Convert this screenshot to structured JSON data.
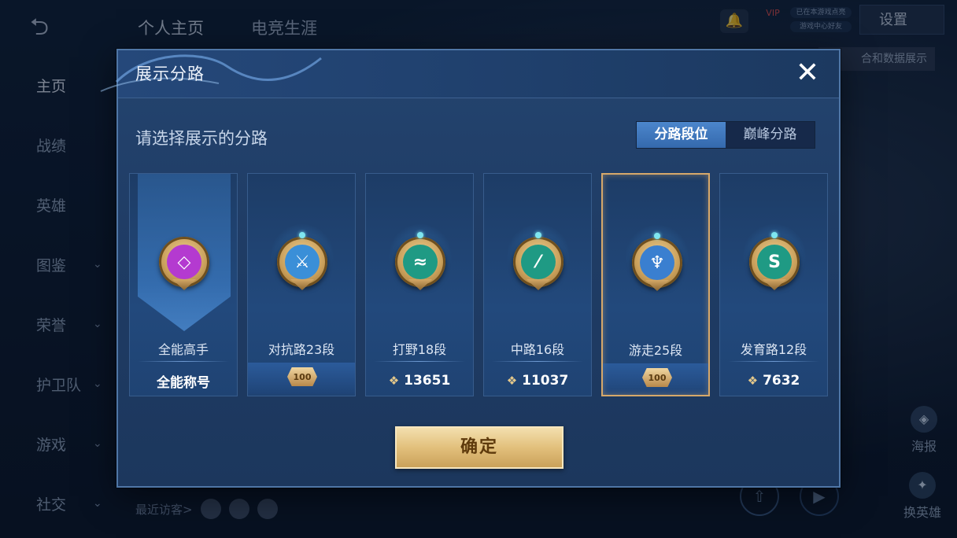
{
  "background": {
    "top_tabs": [
      "个人主页",
      "电竞生涯"
    ],
    "vip_label": "VIP",
    "status_lines": [
      "已在本游戏点亮",
      "游戏中心好友"
    ],
    "settings_label": "设置",
    "data_strip_label": "合和数据展示",
    "side_nav": [
      {
        "label": "主页",
        "has_chevron": false
      },
      {
        "label": "战绩",
        "has_chevron": false
      },
      {
        "label": "英雄",
        "has_chevron": false
      },
      {
        "label": "图鉴",
        "has_chevron": true
      },
      {
        "label": "荣誉",
        "has_chevron": true
      },
      {
        "label": "护卫队",
        "has_chevron": true
      },
      {
        "label": "游戏",
        "has_chevron": true
      },
      {
        "label": "社交",
        "has_chevron": true
      }
    ],
    "right_buttons": [
      {
        "label": "海报",
        "icon": "poster-icon"
      },
      {
        "label": "换英雄",
        "icon": "swap-hero-icon"
      }
    ],
    "recent_visitors_label": "最近访客>"
  },
  "modal": {
    "title": "展示分路",
    "subtitle": "请选择展示的分路",
    "tabs": [
      {
        "label": "分路段位",
        "active": true
      },
      {
        "label": "巅峰分路",
        "active": false
      }
    ],
    "cards": [
      {
        "name": "全能高手",
        "footer": "全能称号",
        "footer_type": "text",
        "badge_color": "#b43ad0",
        "badge_glyph": "◇",
        "selected": false
      },
      {
        "name": "对抗路23段",
        "footer": "100",
        "footer_type": "crest",
        "badge_color": "#3a8fd8",
        "badge_glyph": "⚔",
        "selected": false
      },
      {
        "name": "打野18段",
        "footer": "13651",
        "footer_type": "score",
        "badge_color": "#1f9a84",
        "badge_glyph": "≈",
        "selected": false
      },
      {
        "name": "中路16段",
        "footer": "11037",
        "footer_type": "score",
        "badge_color": "#1f9a84",
        "badge_glyph": "⁄",
        "selected": false
      },
      {
        "name": "游走25段",
        "footer": "100",
        "footer_type": "crest",
        "badge_color": "#3a7fd0",
        "badge_glyph": "♆",
        "selected": true
      },
      {
        "name": "发育路12段",
        "footer": "7632",
        "footer_type": "score",
        "badge_color": "#1f9a84",
        "badge_glyph": "S",
        "selected": false
      }
    ],
    "confirm_label": "确定"
  }
}
